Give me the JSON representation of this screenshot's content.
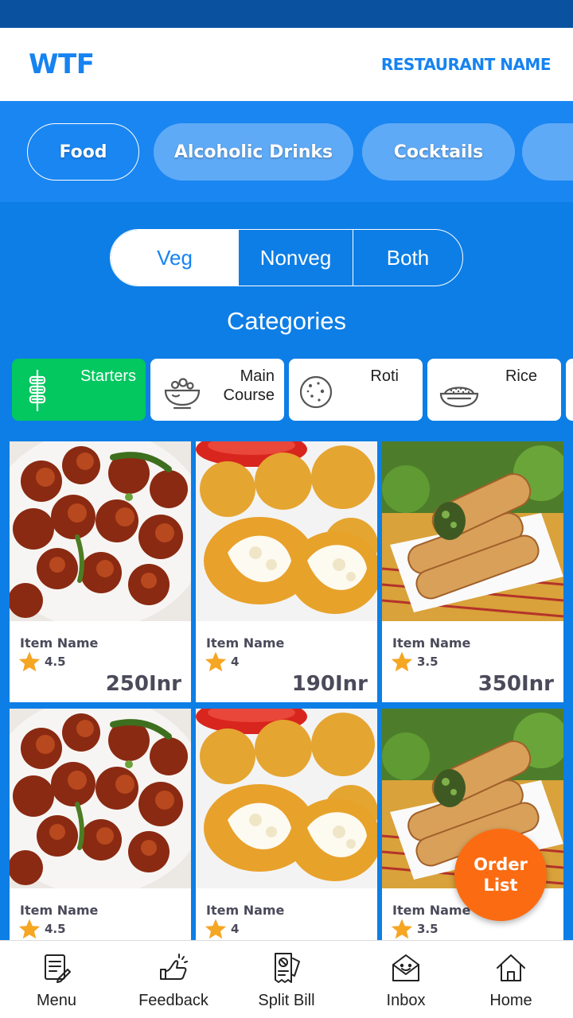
{
  "header": {
    "logo": "WTF",
    "restaurant_name": "RESTAURANT NAME"
  },
  "top_tabs": [
    {
      "label": "Food",
      "active": true
    },
    {
      "label": "Alcoholic Drinks",
      "active": false
    },
    {
      "label": "Cocktails",
      "active": false
    },
    {
      "label": "",
      "active": false
    }
  ],
  "diet_filter": {
    "options": [
      "Veg",
      "Nonveg",
      "Both"
    ],
    "selected": "Veg"
  },
  "categories_title": "Categories",
  "categories": [
    {
      "label": "Starters",
      "icon": "skewer-icon",
      "selected": true
    },
    {
      "label": "Main Course",
      "icon": "bowl-icon",
      "selected": false
    },
    {
      "label": "Roti",
      "icon": "roti-icon",
      "selected": false
    },
    {
      "label": "Rice",
      "icon": "rice-icon",
      "selected": false
    }
  ],
  "items": [
    {
      "name": "Item Name",
      "rating": "4.5",
      "price": "250Inr",
      "image": "gobi-manchurian"
    },
    {
      "name": "Item Name",
      "rating": "4",
      "price": "190Inr",
      "image": "gobi-pakora"
    },
    {
      "name": "Item Name",
      "rating": "3.5",
      "price": "350Inr",
      "image": "spring-rolls"
    },
    {
      "name": "Item Name",
      "rating": "4.5",
      "price": "",
      "image": "gobi-manchurian"
    },
    {
      "name": "Item Name",
      "rating": "4",
      "price": "",
      "image": "gobi-pakora"
    },
    {
      "name": "Item Name",
      "rating": "3.5",
      "price": "",
      "image": "spring-rolls"
    }
  ],
  "order_fab": {
    "line1": "Order",
    "line2": "List"
  },
  "bottom_nav": [
    {
      "label": "Menu",
      "icon": "menu-icon"
    },
    {
      "label": "Feedback",
      "icon": "feedback-icon"
    },
    {
      "label": "Split Bill",
      "icon": "split-bill-icon"
    },
    {
      "label": "Inbox",
      "icon": "inbox-icon"
    },
    {
      "label": "Home",
      "icon": "home-icon"
    }
  ],
  "colors": {
    "primary": "#1683f0",
    "tab_bg": "#1a86f2",
    "main_bg": "#0d7ee6",
    "selected_category": "#03c75f",
    "fab": "#fb6b12",
    "star": "#f5a623"
  }
}
